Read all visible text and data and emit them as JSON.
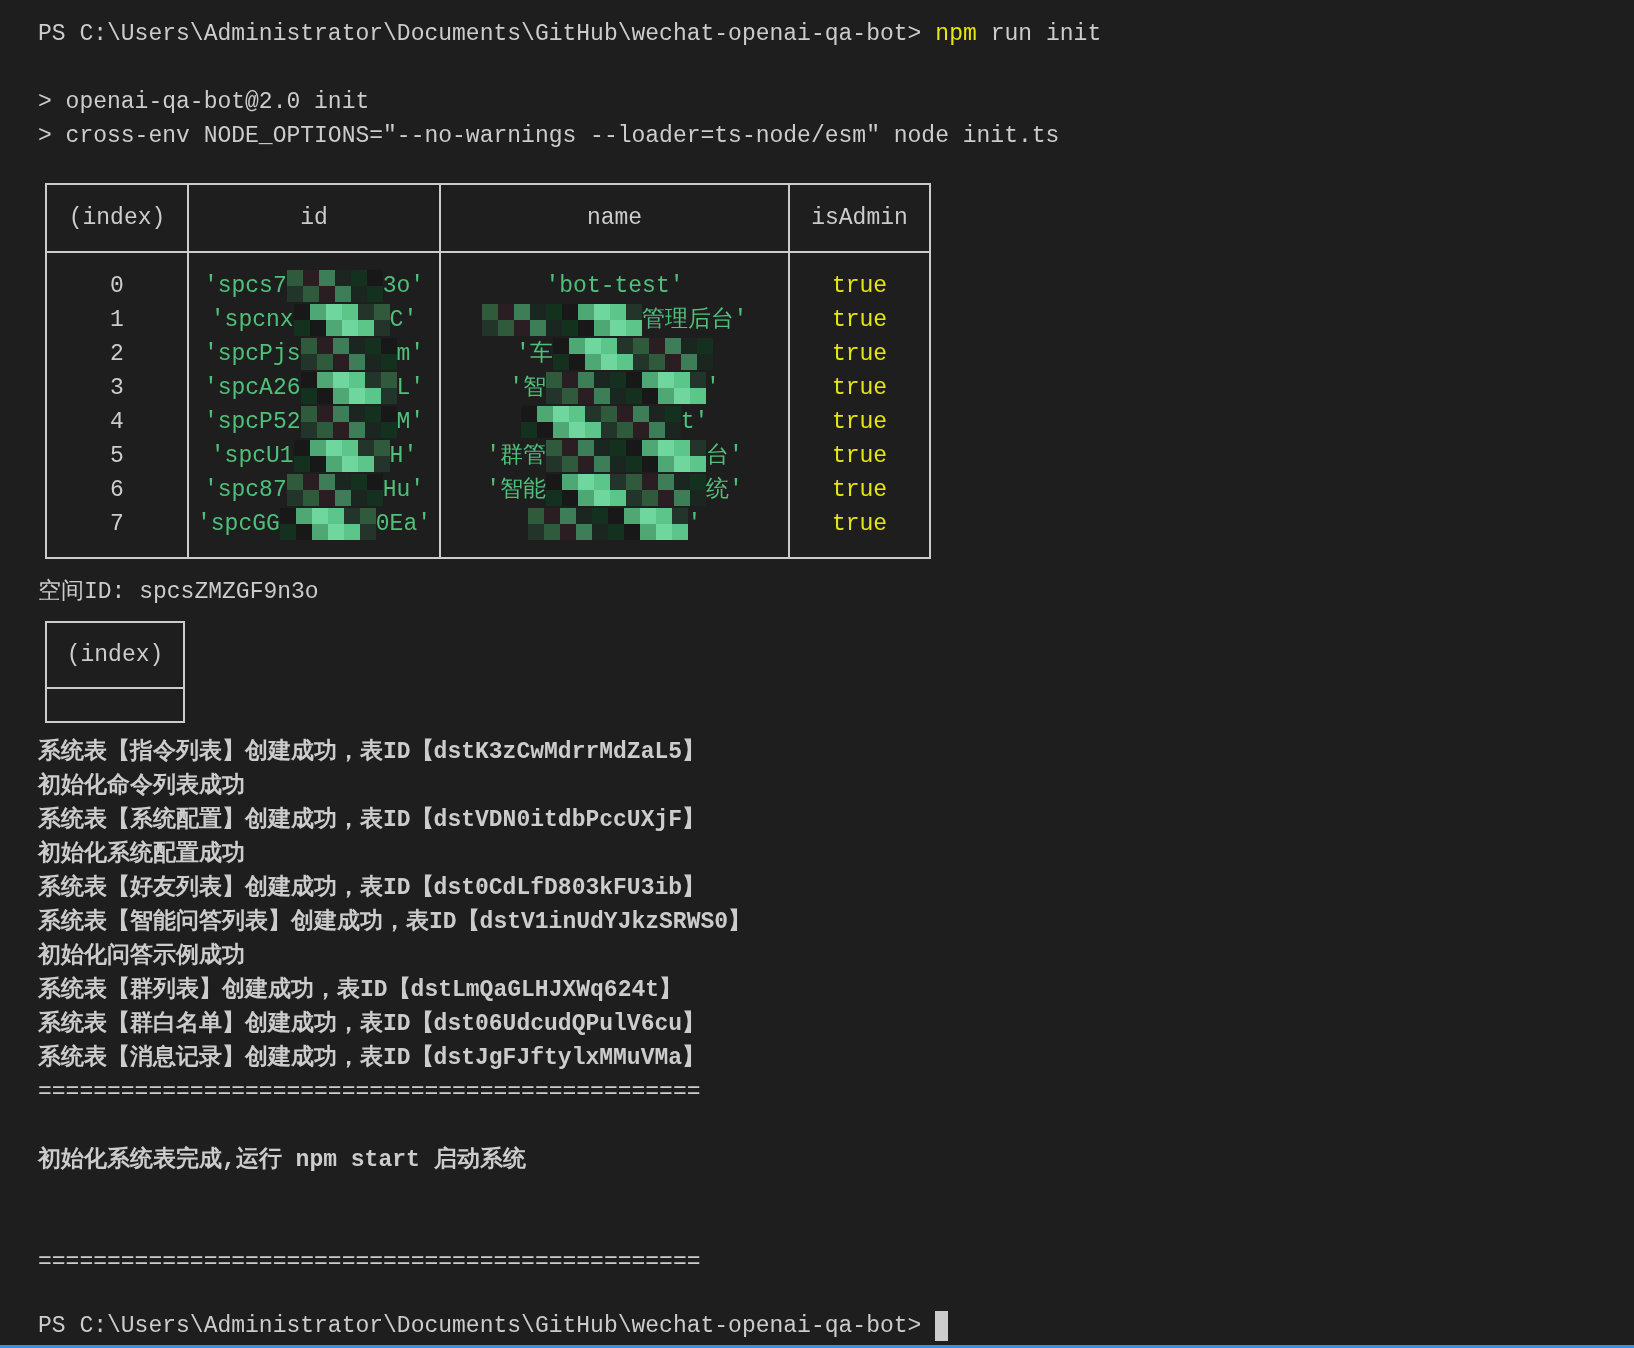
{
  "prompt_top": {
    "path": "PS C:\\Users\\Administrator\\Documents\\GitHub\\wechat-openai-qa-bot>",
    "command_highlight": "npm",
    "command_rest": "run init"
  },
  "script_lines": [
    "> openai-qa-bot@2.0 init",
    "> cross-env NODE_OPTIONS=\"--no-warnings --loader=ts-node/esm\" node init.ts"
  ],
  "table": {
    "columns": [
      "(index)",
      "id",
      "name",
      "isAdmin"
    ],
    "rows": [
      {
        "index": "0",
        "id": {
          "start": "'spcs7",
          "end": "3o'",
          "redacted": true
        },
        "name": {
          "start": "'bot-test'",
          "redacted": false
        },
        "is_admin": "true"
      },
      {
        "index": "1",
        "id": {
          "start": "'spcnx",
          "end": "C'",
          "redacted": true
        },
        "name": {
          "end": "管理后台'",
          "redacted": true
        },
        "is_admin": "true"
      },
      {
        "index": "2",
        "id": {
          "start": "'spcPjs",
          "end": "m'",
          "redacted": true
        },
        "name": {
          "start": "'车",
          "redacted": true
        },
        "is_admin": "true"
      },
      {
        "index": "3",
        "id": {
          "start": "'spcA26",
          "end": "L'",
          "redacted": true
        },
        "name": {
          "start": "'智",
          "end": "'",
          "redacted": true
        },
        "is_admin": "true"
      },
      {
        "index": "4",
        "id": {
          "start": "'spcP52",
          "end": "M'",
          "redacted": true
        },
        "name": {
          "end": "t'",
          "redacted": true
        },
        "is_admin": "true"
      },
      {
        "index": "5",
        "id": {
          "start": "'spcU1",
          "end": "H'",
          "redacted": true
        },
        "name": {
          "start": "'群管",
          "end": "台'",
          "redacted": true
        },
        "is_admin": "true"
      },
      {
        "index": "6",
        "id": {
          "start": "'spc87",
          "end": "Hu'",
          "redacted": true
        },
        "name": {
          "start": "'智能",
          "end": "统'",
          "redacted": true
        },
        "is_admin": "true"
      },
      {
        "index": "7",
        "id": {
          "start": "'spcGG",
          "end": "0Ea'",
          "redacted": true
        },
        "name": {
          "end": "'",
          "redacted": true
        },
        "is_admin": "true"
      }
    ]
  },
  "space_id_line": "空间ID: spcsZMZGF9n3o",
  "empty_table": {
    "columns": [
      "(index)"
    ]
  },
  "log_lines": [
    "系统表【指令列表】创建成功，表ID【dstK3zCwMdrrMdZaL5】",
    "初始化命令列表成功",
    "系统表【系统配置】创建成功，表ID【dstVDN0itdbPccUXjF】",
    "初始化系统配置成功",
    "系统表【好友列表】创建成功，表ID【dst0CdLfD803kFU3ib】",
    "系统表【智能问答列表】创建成功，表ID【dstV1inUdYJkzSRWS0】",
    "初始化问答示例成功",
    "系统表【群列表】创建成功，表ID【dstLmQaGLHJXWq624t】",
    "系统表【群白名单】创建成功，表ID【dst06UdcudQPulV6cu】",
    "系统表【消息记录】创建成功，表ID【dstJgFJftylxMMuVMa】"
  ],
  "separator_top": "================================================",
  "done_message": "初始化系统表完成,运行 npm start 启动系统",
  "separator_bottom": "================================================",
  "prompt_bottom": {
    "path": "PS C:\\Users\\Administrator\\Documents\\GitHub\\wechat-openai-qa-bot>",
    "cursor": true
  }
}
